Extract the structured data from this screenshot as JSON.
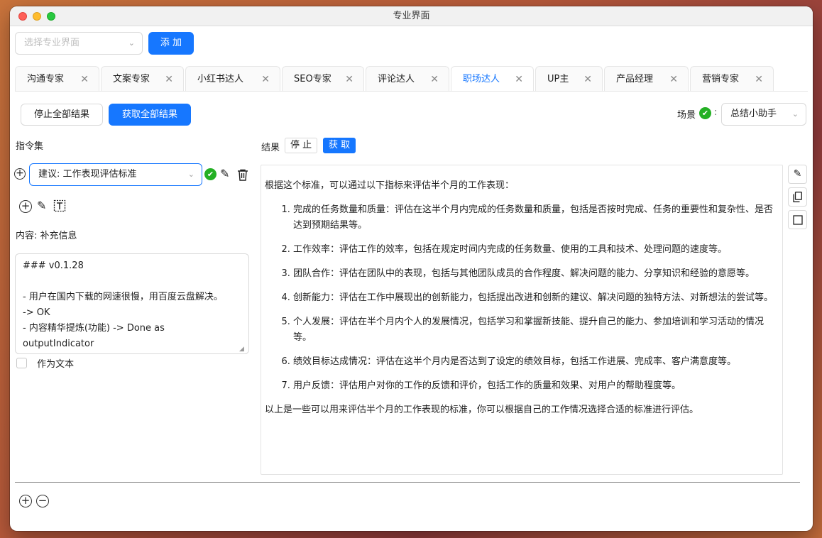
{
  "window": {
    "title": "专业界面"
  },
  "toolbar": {
    "select_placeholder": "选择专业界面",
    "add_label": "添 加"
  },
  "tabs": [
    {
      "label": "沟通专家"
    },
    {
      "label": "文案专家"
    },
    {
      "label": "小红书达人"
    },
    {
      "label": "SEO专家"
    },
    {
      "label": "评论达人"
    },
    {
      "label": "职场达人",
      "active": true
    },
    {
      "label": "UP主"
    },
    {
      "label": "产品经理"
    },
    {
      "label": "营销专家"
    }
  ],
  "controls": {
    "stop_all_label": "停止全部结果",
    "fetch_all_label": "获取全部结果",
    "scene_label": "场景",
    "scene_value": "总结小助手"
  },
  "left": {
    "commands_label": "指令集",
    "command_value": "建议: 工作表现评估标准",
    "content_label": "内容: 补充信息",
    "content_text": "### v0.1.28\n\n- 用户在国内下载的网速很慢，用百度云盘解决。\n-> OK\n- 内容精华提炼(功能) -> Done as\noutputIndicator",
    "as_text_label": "作为文本"
  },
  "result": {
    "label": "结果",
    "stop_label": "停 止",
    "fetch_label": "获 取",
    "intro": "根据这个标准，可以通过以下指标来评估半个月的工作表现：",
    "items": [
      "完成的任务数量和质量：评估在这半个月内完成的任务数量和质量，包括是否按时完成、任务的重要性和复杂性、是否达到预期结果等。",
      "工作效率：评估工作的效率，包括在规定时间内完成的任务数量、使用的工具和技术、处理问题的速度等。",
      "团队合作：评估在团队中的表现，包括与其他团队成员的合作程度、解决问题的能力、分享知识和经验的意愿等。",
      "创新能力：评估在工作中展现出的创新能力，包括提出改进和创新的建议、解决问题的独特方法、对新想法的尝试等。",
      "个人发展：评估在半个月内个人的发展情况，包括学习和掌握新技能、提升自己的能力、参加培训和学习活动的情况等。",
      "绩效目标达成情况：评估在这半个月内是否达到了设定的绩效目标，包括工作进展、完成率、客户满意度等。",
      "用户反馈：评估用户对你的工作的反馈和评价，包括工作的质量和效果、对用户的帮助程度等。"
    ],
    "outro": "以上是一些可以用来评估半个月的工作表现的标准，你可以根据自己的工作情况选择合适的标准进行评估。"
  },
  "colors": {
    "accent": "#1677ff",
    "success": "#24b024"
  }
}
